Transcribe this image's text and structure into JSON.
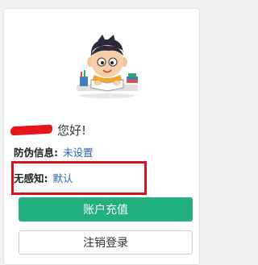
{
  "profile": {
    "greeting": "您好!"
  },
  "anti_fake": {
    "label": "防伪信息:",
    "value": "未设置"
  },
  "seamless": {
    "label": "无感知:",
    "value": "默认"
  },
  "buttons": {
    "recharge": "账户充值",
    "logout": "注销登录"
  },
  "colors": {
    "accent_green": "#21b07e",
    "link_blue": "#2b5fb7",
    "highlight_red": "#d6141e"
  },
  "icons": {
    "avatar": "cartoon-student-avatar-icon"
  }
}
